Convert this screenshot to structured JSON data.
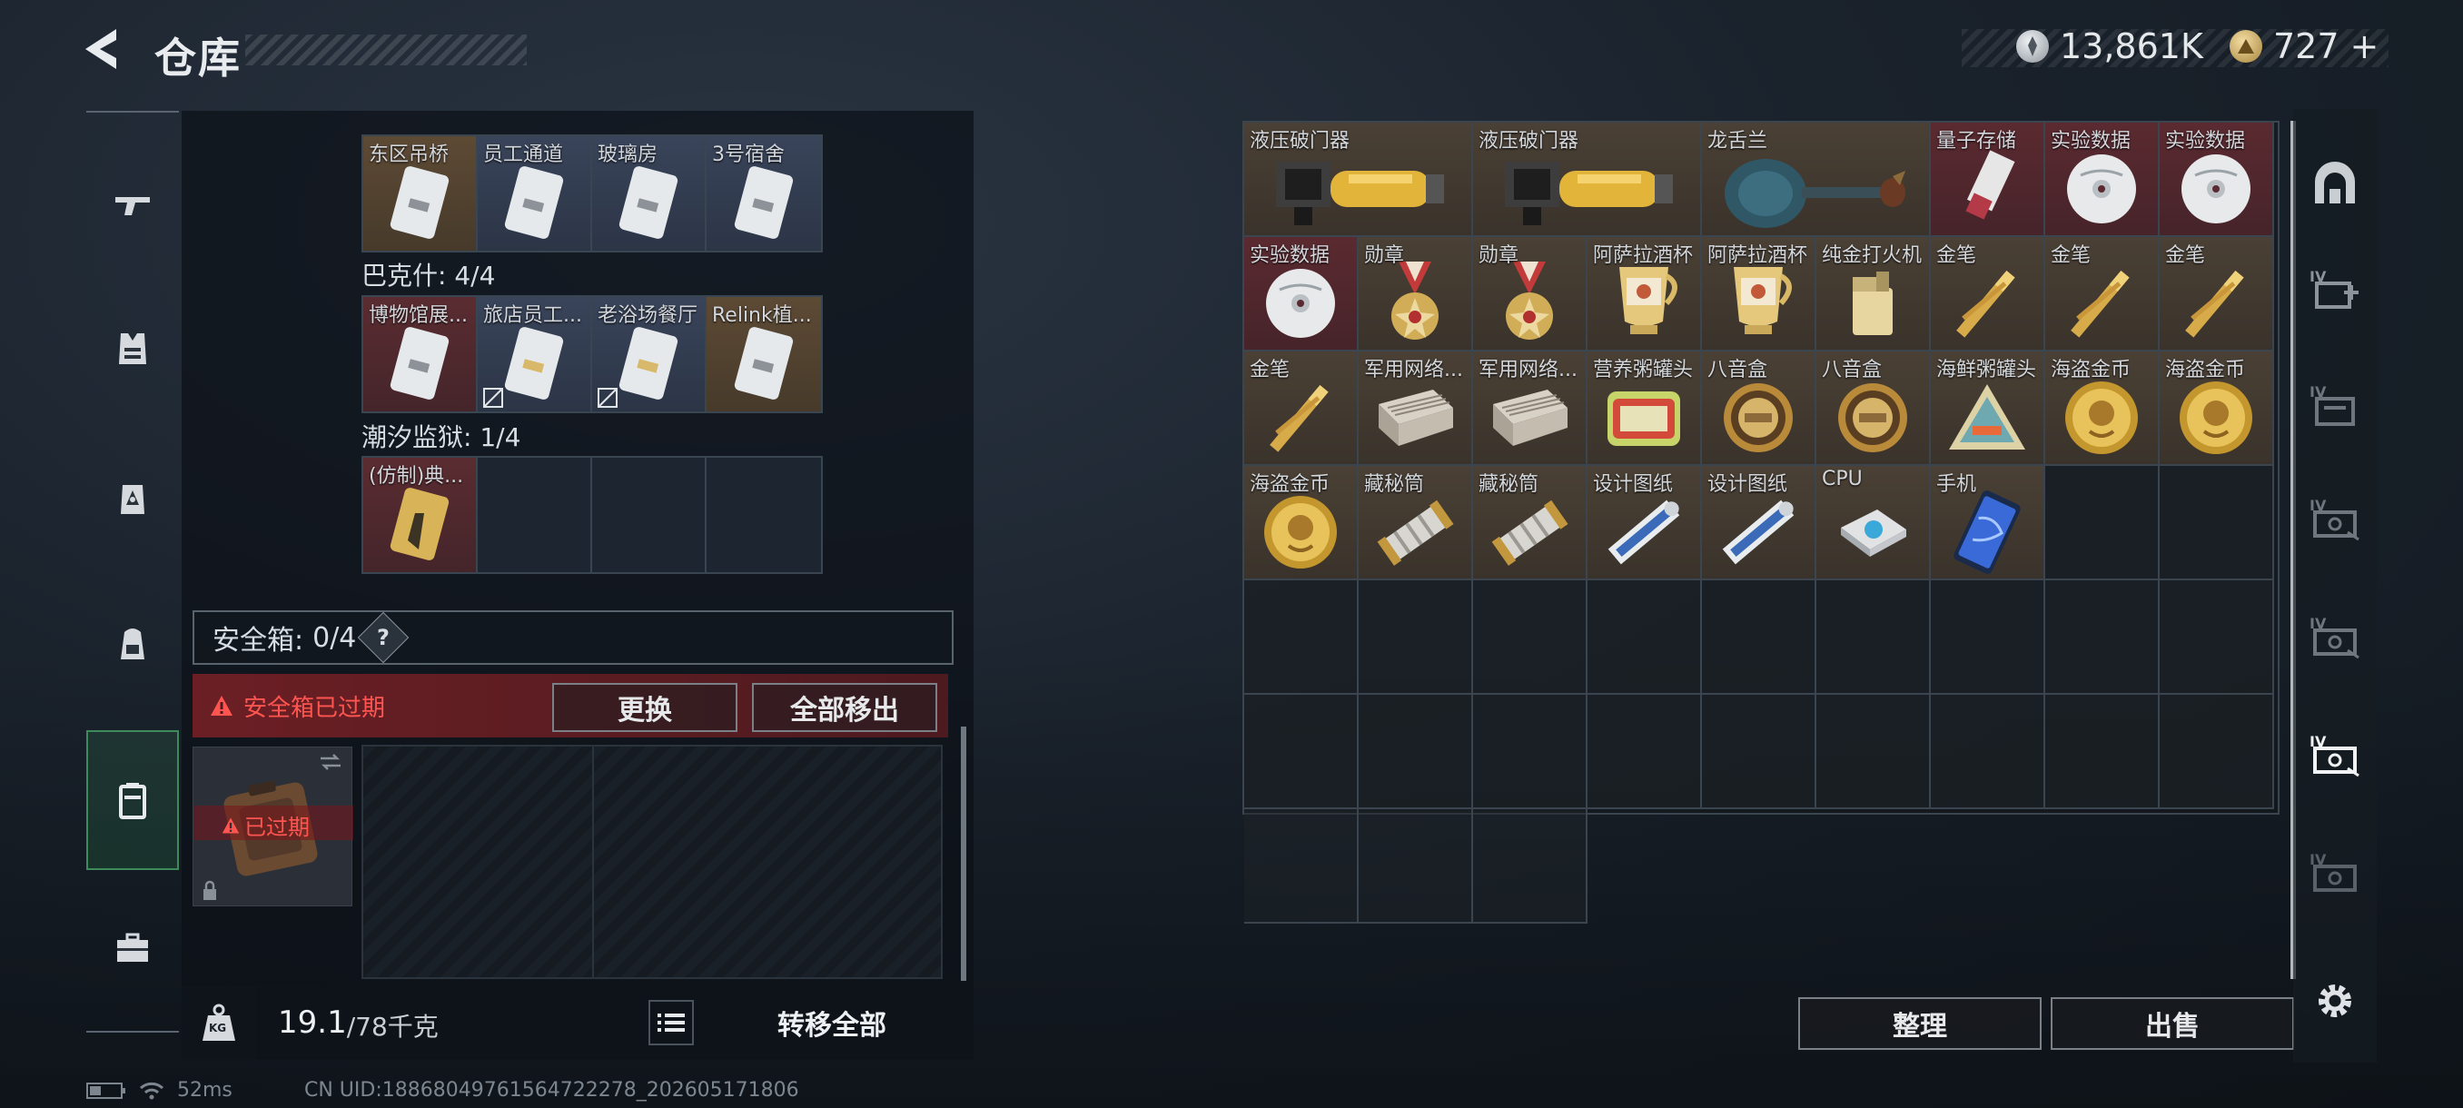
{
  "header": {
    "title": "仓库",
    "currency": [
      {
        "icon": "silver-coin-icon",
        "value": "13,861K"
      },
      {
        "icon": "gold-coin-icon",
        "value": "727"
      }
    ],
    "add_label": "+"
  },
  "sidebar": {
    "items": [
      {
        "name": "weapon",
        "icon": "gun-icon"
      },
      {
        "name": "armor",
        "icon": "vest-icon"
      },
      {
        "name": "rig",
        "icon": "chest-rig-icon"
      },
      {
        "name": "backpack",
        "icon": "backpack-icon"
      },
      {
        "name": "safebox",
        "icon": "safe-case-icon",
        "active": true
      },
      {
        "name": "toolbox",
        "icon": "toolbox-icon"
      }
    ]
  },
  "left_panel": {
    "keycards_top": [
      {
        "label": "东区吊桥",
        "bg": "gold"
      },
      {
        "label": "员工通道",
        "bg": "blue"
      },
      {
        "label": "玻璃房",
        "bg": "blue"
      },
      {
        "label": "3号宿舍",
        "bg": "blue"
      }
    ],
    "bakshi_label": "巴克什: 4/4",
    "bakshi": [
      {
        "label": "博物馆展...",
        "bg": "red"
      },
      {
        "label": "旅店员工...",
        "bg": "blue"
      },
      {
        "label": "老浴场餐厅",
        "bg": "blue"
      },
      {
        "label": "Relink植...",
        "bg": "gold"
      }
    ],
    "prison_label": "潮汐监狱: 1/4",
    "prison": [
      {
        "label": "(仿制)典...",
        "bg": "red"
      }
    ],
    "safebox_label": "安全箱:",
    "safebox_count": "0/4",
    "help": "?",
    "expired_msg": "安全箱已过期",
    "replace_btn": "更换",
    "move_all_btn": "全部移出",
    "case_expired": "已过期",
    "weight_value": "19.1",
    "weight_max": "/78千克",
    "weight_icon_label": "KG",
    "transfer_all": "转移全部"
  },
  "warehouse": {
    "items": [
      {
        "label": "液压破门器",
        "bg": "brown",
        "wide": true,
        "icon": "breacher"
      },
      {
        "label": "液压破门器",
        "bg": "brown",
        "wide": true,
        "icon": "breacher"
      },
      {
        "label": "龙舌兰",
        "bg": "brown",
        "wide": true,
        "icon": "tequila"
      },
      {
        "label": "量子存储",
        "bg": "red",
        "icon": "usb"
      },
      {
        "label": "实验数据",
        "bg": "red",
        "icon": "disc"
      },
      {
        "label": "实验数据",
        "bg": "red",
        "icon": "disc"
      },
      {
        "label": "实验数据",
        "bg": "red",
        "icon": "disc"
      },
      {
        "label": "勋章",
        "bg": "brown",
        "icon": "medal"
      },
      {
        "label": "勋章",
        "bg": "brown",
        "icon": "medal"
      },
      {
        "label": "阿萨拉酒杯",
        "bg": "brown",
        "icon": "cup"
      },
      {
        "label": "阿萨拉酒杯",
        "bg": "brown",
        "icon": "cup"
      },
      {
        "label": "纯金打火机",
        "bg": "brown",
        "icon": "lighter"
      },
      {
        "label": "金笔",
        "bg": "brown",
        "icon": "pen"
      },
      {
        "label": "金笔",
        "bg": "brown",
        "icon": "pen"
      },
      {
        "label": "金笔",
        "bg": "brown",
        "icon": "pen"
      },
      {
        "label": "金笔",
        "bg": "brown",
        "icon": "pen"
      },
      {
        "label": "军用网络...",
        "bg": "brown",
        "icon": "router"
      },
      {
        "label": "军用网络...",
        "bg": "brown",
        "icon": "router"
      },
      {
        "label": "营养粥罐头",
        "bg": "brown",
        "icon": "can"
      },
      {
        "label": "八音盒",
        "bg": "brown",
        "icon": "musicbox"
      },
      {
        "label": "八音盒",
        "bg": "brown",
        "icon": "musicbox"
      },
      {
        "label": "海鲜粥罐头",
        "bg": "brown",
        "icon": "trican"
      },
      {
        "label": "海盗金币",
        "bg": "brown",
        "icon": "coin"
      },
      {
        "label": "海盗金币",
        "bg": "brown",
        "icon": "coin"
      },
      {
        "label": "海盗金币",
        "bg": "brown",
        "icon": "coin"
      },
      {
        "label": "藏秘筒",
        "bg": "brown",
        "icon": "cryptex"
      },
      {
        "label": "藏秘筒",
        "bg": "brown",
        "icon": "cryptex"
      },
      {
        "label": "设计图纸",
        "bg": "brown",
        "icon": "blueprint"
      },
      {
        "label": "设计图纸",
        "bg": "brown",
        "icon": "blueprint"
      },
      {
        "label": "CPU",
        "bg": "brown",
        "icon": "cpu"
      },
      {
        "label": "手机",
        "bg": "brown",
        "icon": "phone"
      }
    ],
    "empty_cells": 23,
    "sort_btn": "整理",
    "sell_btn": "出售"
  },
  "right_sidebar": {
    "tabs": [
      {
        "icon": "home-arch-icon"
      },
      {
        "icon": "add-storage-icon",
        "badge": "IV"
      },
      {
        "icon": "storage-folder-icon",
        "badge": "IV"
      },
      {
        "icon": "storage-tab-icon",
        "badge": "IV"
      },
      {
        "icon": "storage-tab-icon",
        "badge": "IV"
      },
      {
        "icon": "storage-tab-icon",
        "badge": "IV",
        "active": true
      },
      {
        "icon": "storage-tab-icon",
        "badge": "IV"
      }
    ]
  },
  "status": {
    "ping": "52ms",
    "uid": "CN UID:18868049761564722278_202605171806"
  }
}
